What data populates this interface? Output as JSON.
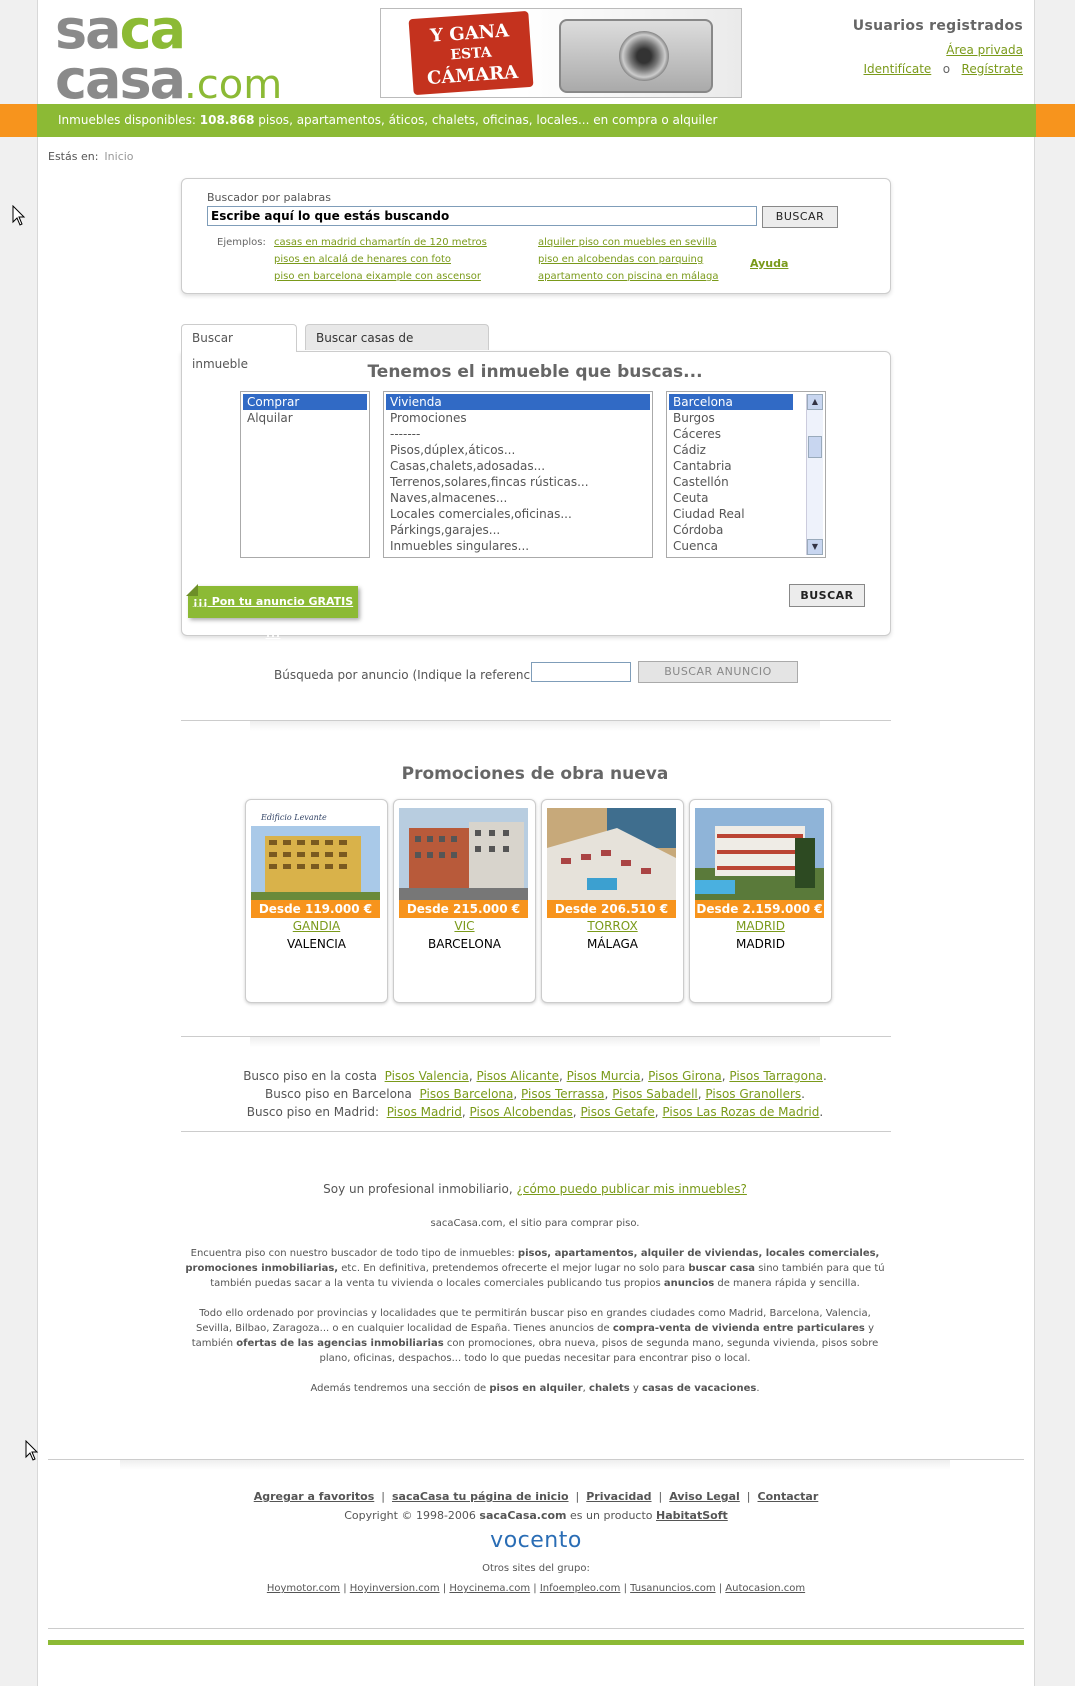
{
  "header": {
    "logo": {
      "line1_a": "sa",
      "line1_b": "ca",
      "line2_a": "ca",
      "line2_b": "sa",
      "suffix": ".com"
    },
    "banner": {
      "text1": "Y GANA",
      "text2": "ESTA",
      "text3": "CÁMARA"
    },
    "users": {
      "title": "Usuarios registrados",
      "area": "Área privada",
      "login": "Identifícate",
      "or": "o",
      "register": "Regístrate"
    }
  },
  "infobar": {
    "prefix": "Inmuebles disponibles:",
    "count": "108.868",
    "suffix": "pisos, apartamentos, áticos, chalets, oficinas, locales... en compra o alquiler"
  },
  "breadcrumb": {
    "label": "Estás en:",
    "home": "Inicio"
  },
  "search": {
    "label": "Buscador por palabras",
    "value": "Escribe aquí lo que estás buscando",
    "button": "BUSCAR",
    "examples_label": "Ejemplos:",
    "examples_col1": [
      "casas en madrid chamartín de 120 metros",
      "pisos en alcalá de henares con foto",
      "piso en barcelona eixample con ascensor"
    ],
    "examples_col2": [
      "alquiler piso con muebles en sevilla",
      "piso en alcobendas con parquing",
      "apartamento con piscina en málaga"
    ],
    "help": "Ayuda"
  },
  "tabs": {
    "tab1": "Buscar inmueble",
    "tab2": "Buscar casas de vacaciones"
  },
  "finder": {
    "title": "Tenemos el inmueble que buscas...",
    "operation": [
      "Comprar",
      "Alquilar"
    ],
    "types": [
      "Vivienda",
      "Promociones",
      "-------",
      "Pisos,dúplex,áticos...",
      "Casas,chalets,adosadas...",
      "Terrenos,solares,fincas rústicas...",
      "Naves,almacenes...",
      "Locales comerciales,oficinas...",
      "Párkings,garajes...",
      "Inmuebles singulares..."
    ],
    "provinces": [
      "Barcelona",
      "Burgos",
      "Cáceres",
      "Cádiz",
      "Cantabria",
      "Castellón",
      "Ceuta",
      "Ciudad Real",
      "Córdoba",
      "Cuenca"
    ],
    "ad_button": "¡¡¡ Pon tu anuncio GRATIS !!!",
    "search_button": "BUSCAR"
  },
  "reference": {
    "label": "Búsqueda por anuncio (Indique la referencia) :",
    "button": "BUSCAR ANUNCIO"
  },
  "promos": {
    "title": "Promociones de obra nueva",
    "items": [
      {
        "price": "Desde 119.000 €",
        "town": "GANDIA",
        "province": "VALENCIA"
      },
      {
        "price": "Desde 215.000 €",
        "town": "VIC",
        "province": "BARCELONA"
      },
      {
        "price": "Desde 206.510 €",
        "town": "TORROX",
        "province": "MÁLAGA"
      },
      {
        "price": "Desde 2.159.000 €",
        "town": "MADRID",
        "province": "MADRID"
      }
    ]
  },
  "quicklinks": {
    "costa_label": "Busco piso en la costa",
    "costa": [
      "Pisos Valencia",
      "Pisos Alicante",
      "Pisos Murcia",
      "Pisos Girona",
      "Pisos Tarragona"
    ],
    "bcn_label": "Busco piso en Barcelona",
    "bcn": [
      "Pisos Barcelona",
      "Pisos Terrassa",
      "Pisos Sabadell",
      "Pisos Granollers"
    ],
    "mad_label": "Busco piso en Madrid:",
    "mad": [
      "Pisos Madrid",
      "Pisos Alcobendas",
      "Pisos Getafe",
      "Pisos Las Rozas de Madrid"
    ]
  },
  "professional": {
    "text": "Soy un profesional inmobiliario,",
    "link": "¿cómo puedo publicar mis inmuebles?"
  },
  "description": {
    "p0": "sacaCasa.com, el sitio para comprar piso.",
    "p1_a": "Encuentra piso con nuestro buscador de todo tipo de inmuebles:",
    "p1_b": "pisos, apartamentos, alquiler de viviendas, locales comerciales, promociones inmobiliarias,",
    "p1_c": "etc. En definitiva, pretendemos ofrecerte el mejor lugar no solo para",
    "p1_d": "buscar casa",
    "p1_e": "sino también para que tú también puedas sacar a la venta tu vivienda o locales comerciales publicando tus propios",
    "p1_f": "anuncios",
    "p1_g": "de manera rápida y sencilla.",
    "p2_a": "Todo ello ordenado por provincias y localidades que te permitirán buscar piso en grandes ciudades como Madrid, Barcelona, Valencia, Sevilla, Bilbao, Zaragoza... o en cualquier localidad de España. Tienes anuncios de",
    "p2_b": "compra-venta de vivienda entre particulares",
    "p2_c": "y también",
    "p2_d": "ofertas de las agencias inmobiliarias",
    "p2_e": "con promociones, obra nueva, pisos de segunda mano, segunda vivienda, pisos sobre plano, oficinas, despachos... todo lo que puedas necesitar para encontrar piso o local.",
    "p3_a": "Además tendremos una sección de",
    "p3_b": "pisos en alquiler",
    "p3_c": ",",
    "p3_d": "chalets",
    "p3_e": "y",
    "p3_f": "casas de vacaciones",
    "p3_g": "."
  },
  "footer": {
    "links": [
      "Agregar a favoritos",
      "sacaCasa tu página de inicio",
      "Privacidad",
      "Aviso Legal",
      "Contactar"
    ],
    "copyright_a": "Copyright © 1998-2006",
    "copyright_b": "sacaCasa.com",
    "copyright_c": "es un producto",
    "copyright_d": "HabitatSoft",
    "vocento": "vocento",
    "others": "Otros sites del grupo:",
    "sites": [
      "Hoymotor.com",
      "Hoyinversion.com",
      "Hoycinema.com",
      "Infoempleo.com",
      "Tusanuncios.com",
      "Autocasion.com"
    ]
  },
  "colors": {
    "green": "#8cba35",
    "orange": "#f7941d",
    "link": "#7a9a1a",
    "vocento": "#2a6db5"
  }
}
